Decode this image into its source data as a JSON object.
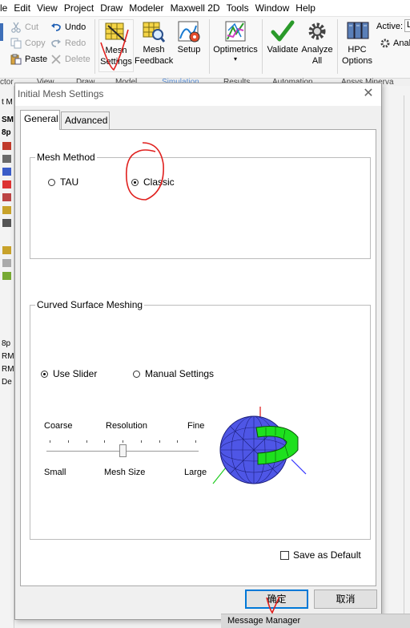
{
  "menubar": [
    "le",
    "Edit",
    "View",
    "Project",
    "Draw",
    "Modeler",
    "Maxwell 2D",
    "Tools",
    "Window",
    "Help"
  ],
  "ribbon": {
    "clipboard": {
      "cut": "Cut",
      "copy": "Copy",
      "paste": "Paste"
    },
    "history": {
      "undo": "Undo",
      "redo": "Redo",
      "delete": "Delete"
    },
    "mesh_line1": "Mesh",
    "mesh_line2": "Settings",
    "feedback_line1": "Mesh",
    "feedback_line2": "Feedback",
    "setup": "Setup",
    "optimetrics": "Optimetrics",
    "validate": "Validate",
    "analyze_line1": "Analyze",
    "analyze_line2": "All",
    "hpc_line1": "HPC",
    "hpc_line2": "Options",
    "active_label": "Active:",
    "active_value": "L",
    "analyze_fragment": "Analy",
    "group_labels": [
      "ctor",
      "View",
      "Draw",
      "Model",
      "Simulation",
      "Results",
      "Automation",
      "Ansys Minerva"
    ]
  },
  "left_strip": [
    "t M",
    "SM",
    "8p",
    "8p",
    "RM",
    "RM",
    "De"
  ],
  "dialog": {
    "title": "Initial Mesh Settings",
    "tabs": [
      "General",
      "Advanced"
    ],
    "mesh_method": {
      "title": "Mesh Method",
      "options": [
        "TAU",
        "Classic"
      ],
      "selected": "Classic"
    },
    "curved": {
      "title": "Curved Surface Meshing",
      "options": [
        "Use Slider",
        "Manual Settings"
      ],
      "selected": "Use Slider",
      "slider_top_labels": [
        "Coarse",
        "Resolution",
        "Fine"
      ],
      "slider_bottom_labels": [
        "Small",
        "Mesh Size",
        "Large"
      ],
      "slider_position": 0.5
    },
    "save_default": "Save as Default",
    "ok": "确定",
    "cancel": "取消"
  },
  "message_manager": "Message Manager"
}
